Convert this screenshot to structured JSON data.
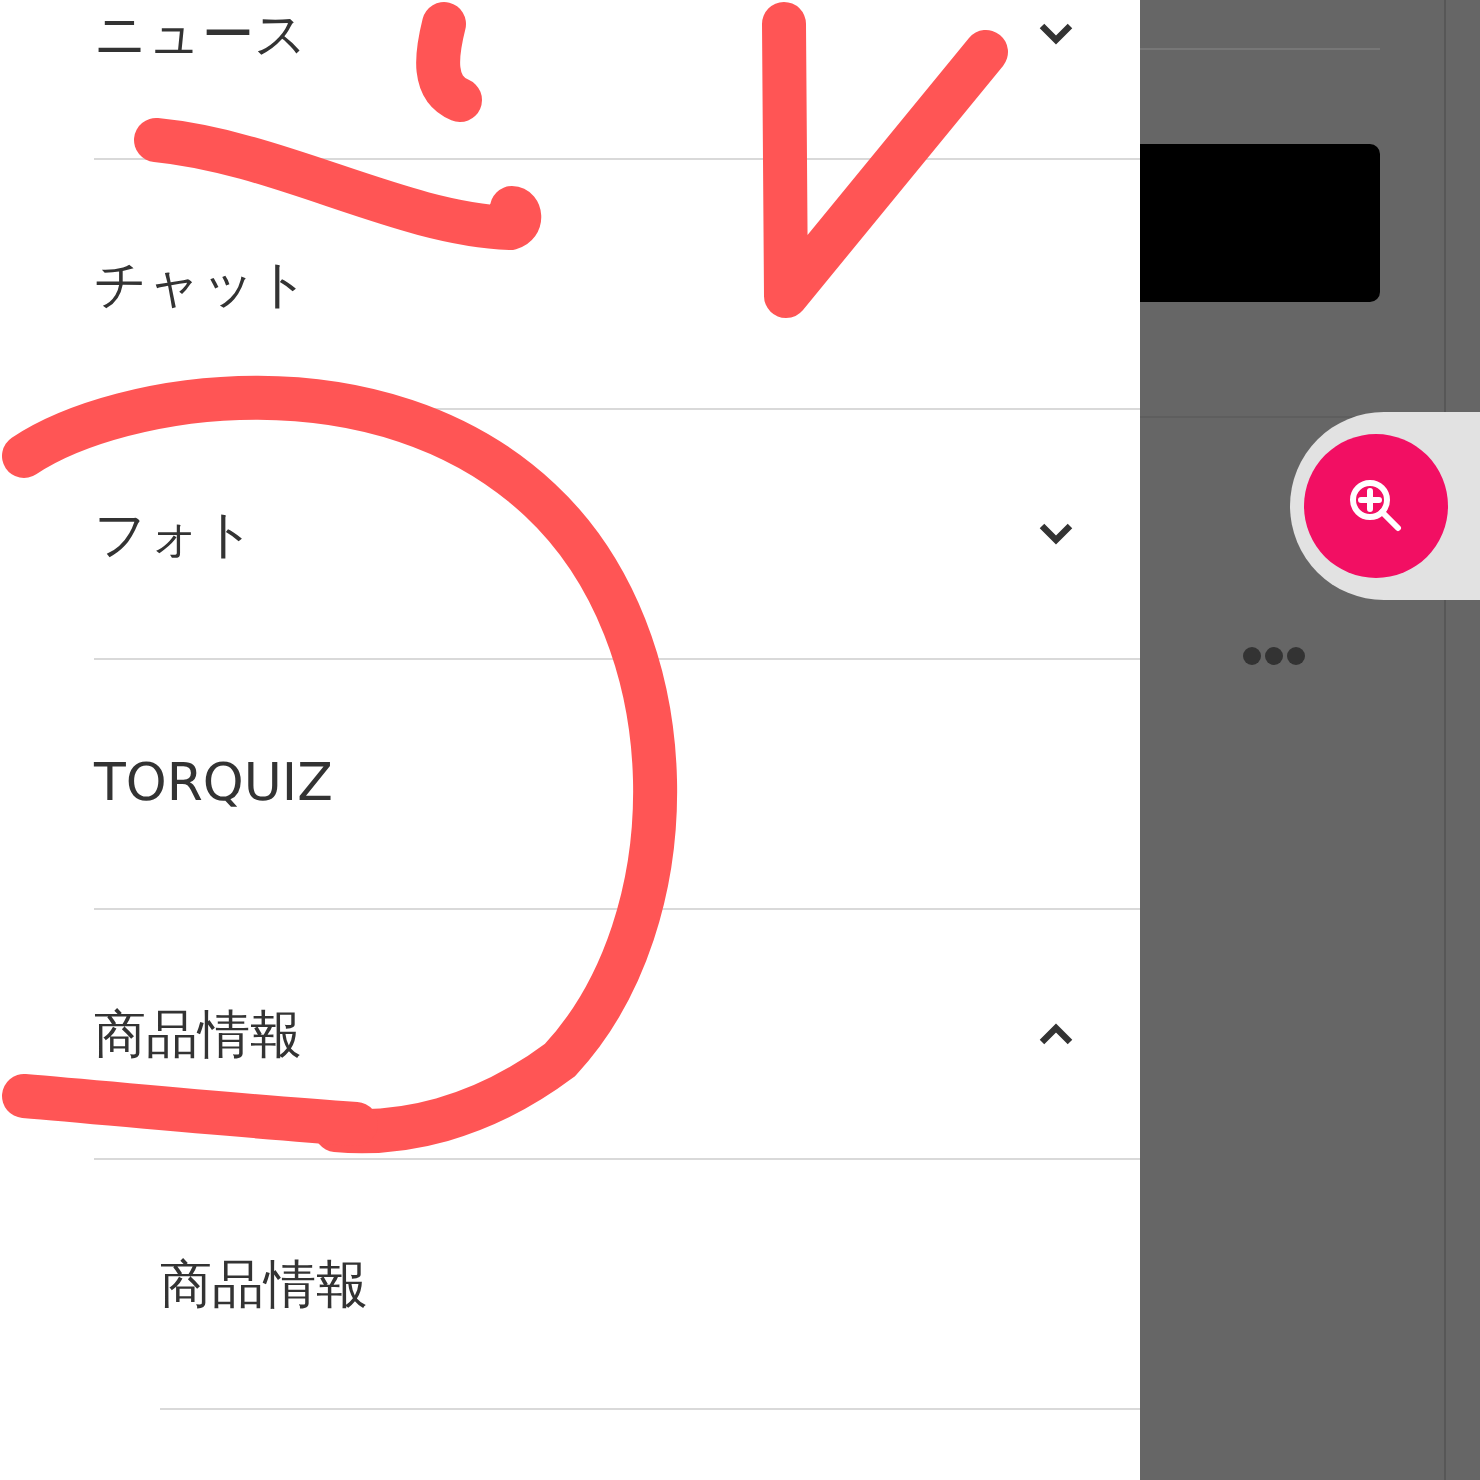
{
  "menu": {
    "items": [
      {
        "label": "ニュース",
        "expanded": false
      },
      {
        "label": "チャット"
      },
      {
        "label": "フォト",
        "expanded": false
      },
      {
        "label": "TORQUIZ"
      },
      {
        "label": "商品情報",
        "expanded": true,
        "children": [
          {
            "label": "商品情報"
          }
        ]
      }
    ]
  }
}
